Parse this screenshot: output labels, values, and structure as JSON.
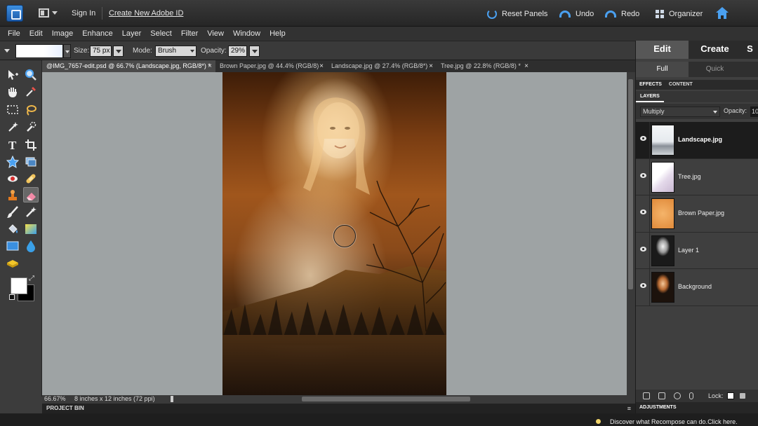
{
  "topbar": {
    "sign_in": "Sign In",
    "create_id": "Create New Adobe ID",
    "reset_panels": "Reset Panels",
    "undo": "Undo",
    "redo": "Redo",
    "organizer": "Organizer"
  },
  "menu": [
    "File",
    "Edit",
    "Image",
    "Enhance",
    "Layer",
    "Select",
    "Filter",
    "View",
    "Window",
    "Help"
  ],
  "options": {
    "size_label": "Size:",
    "size_value": "75 px",
    "mode_label": "Mode:",
    "mode_value": "Brush",
    "opacity_label": "Opacity:",
    "opacity_value": "29%"
  },
  "doc_tabs": [
    {
      "label": "@IMG_7657-edit.psd @ 66.7% (Landscape.jpg, RGB/8*) *",
      "close": "×"
    },
    {
      "label": "Brown Paper.jpg @ 44.4% (RGB/8)",
      "close": "×"
    },
    {
      "label": "Landscape.jpg @ 27.4% (RGB/8*)",
      "close": "×"
    },
    {
      "label": "Tree.jpg @ 22.8% (RGB/8) *",
      "close": "×"
    }
  ],
  "status": {
    "zoom": "66.67%",
    "doc_info": "8 inches x 12 inches (72 ppi)"
  },
  "project_bin": "PROJECT BIN",
  "project_bin_menu": "≡",
  "right_panel": {
    "mode_tabs": [
      "Edit",
      "Create",
      "S"
    ],
    "sub_tabs": [
      "Full",
      "Quick"
    ],
    "panel_tabs": [
      "EFFECTS",
      "CONTENT"
    ],
    "layers_title": "LAYERS",
    "blend_mode": "Multiply",
    "opacity_label": "Opacity:",
    "opacity_value": "10",
    "layers": [
      {
        "name": "Landscape.jpg"
      },
      {
        "name": "Tree.jpg"
      },
      {
        "name": "Brown Paper.jpg"
      },
      {
        "name": "Layer 1"
      },
      {
        "name": "Background"
      }
    ],
    "lock_label": "Lock:",
    "adjustments_title": "ADJUSTMENTS"
  },
  "hint": "Discover what Recompose can do.Click here.",
  "colors": {
    "accent": "#4aa0f0",
    "fg_color": "#ffffff",
    "bg_color": "#000000"
  }
}
